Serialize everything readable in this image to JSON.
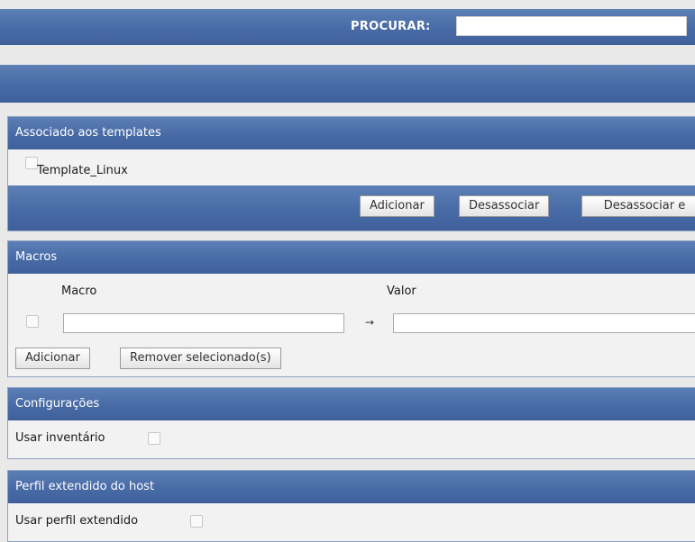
{
  "header": {
    "search_label": "PROCURAR:",
    "search_value": ""
  },
  "templates": {
    "title": "Associado aos templates",
    "items": [
      {
        "name": "Template_Linux"
      }
    ],
    "buttons": {
      "add": "Adicionar",
      "unlink": "Desassociar",
      "unlink_clear": "Desassociar e"
    }
  },
  "macros": {
    "title": "Macros",
    "columns": {
      "macro": "Macro",
      "value": "Valor"
    },
    "row": {
      "macro_value": "",
      "value_value": ""
    },
    "arrow": "→",
    "buttons": {
      "add": "Adicionar",
      "remove": "Remover selecionado(s)"
    }
  },
  "settings": {
    "title": "Configurações",
    "inventory_label": "Usar inventário"
  },
  "profile": {
    "title": "Perfil extendido do host",
    "label": "Usar perfil extendido"
  },
  "colors": {
    "header_blue": "#486ba6",
    "panel_bg": "#f2f2f2",
    "page_bg": "#e9e9e9"
  }
}
